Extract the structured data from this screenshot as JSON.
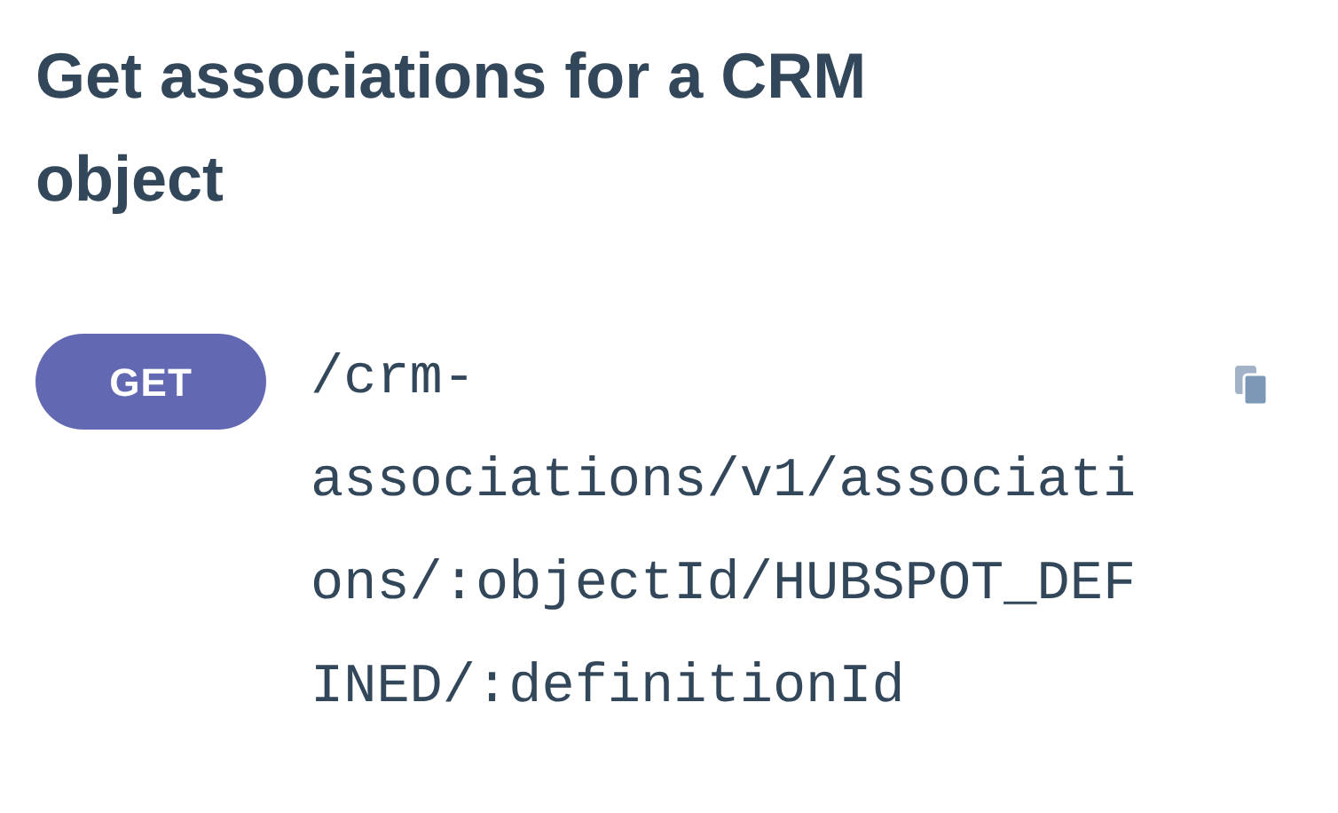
{
  "title": "Get associations for a CRM object",
  "endpoint": {
    "method": "GET",
    "path": "/crm-associations/v1/associations/:objectId/HUBSPOT_DEFINED/:definitionId"
  }
}
